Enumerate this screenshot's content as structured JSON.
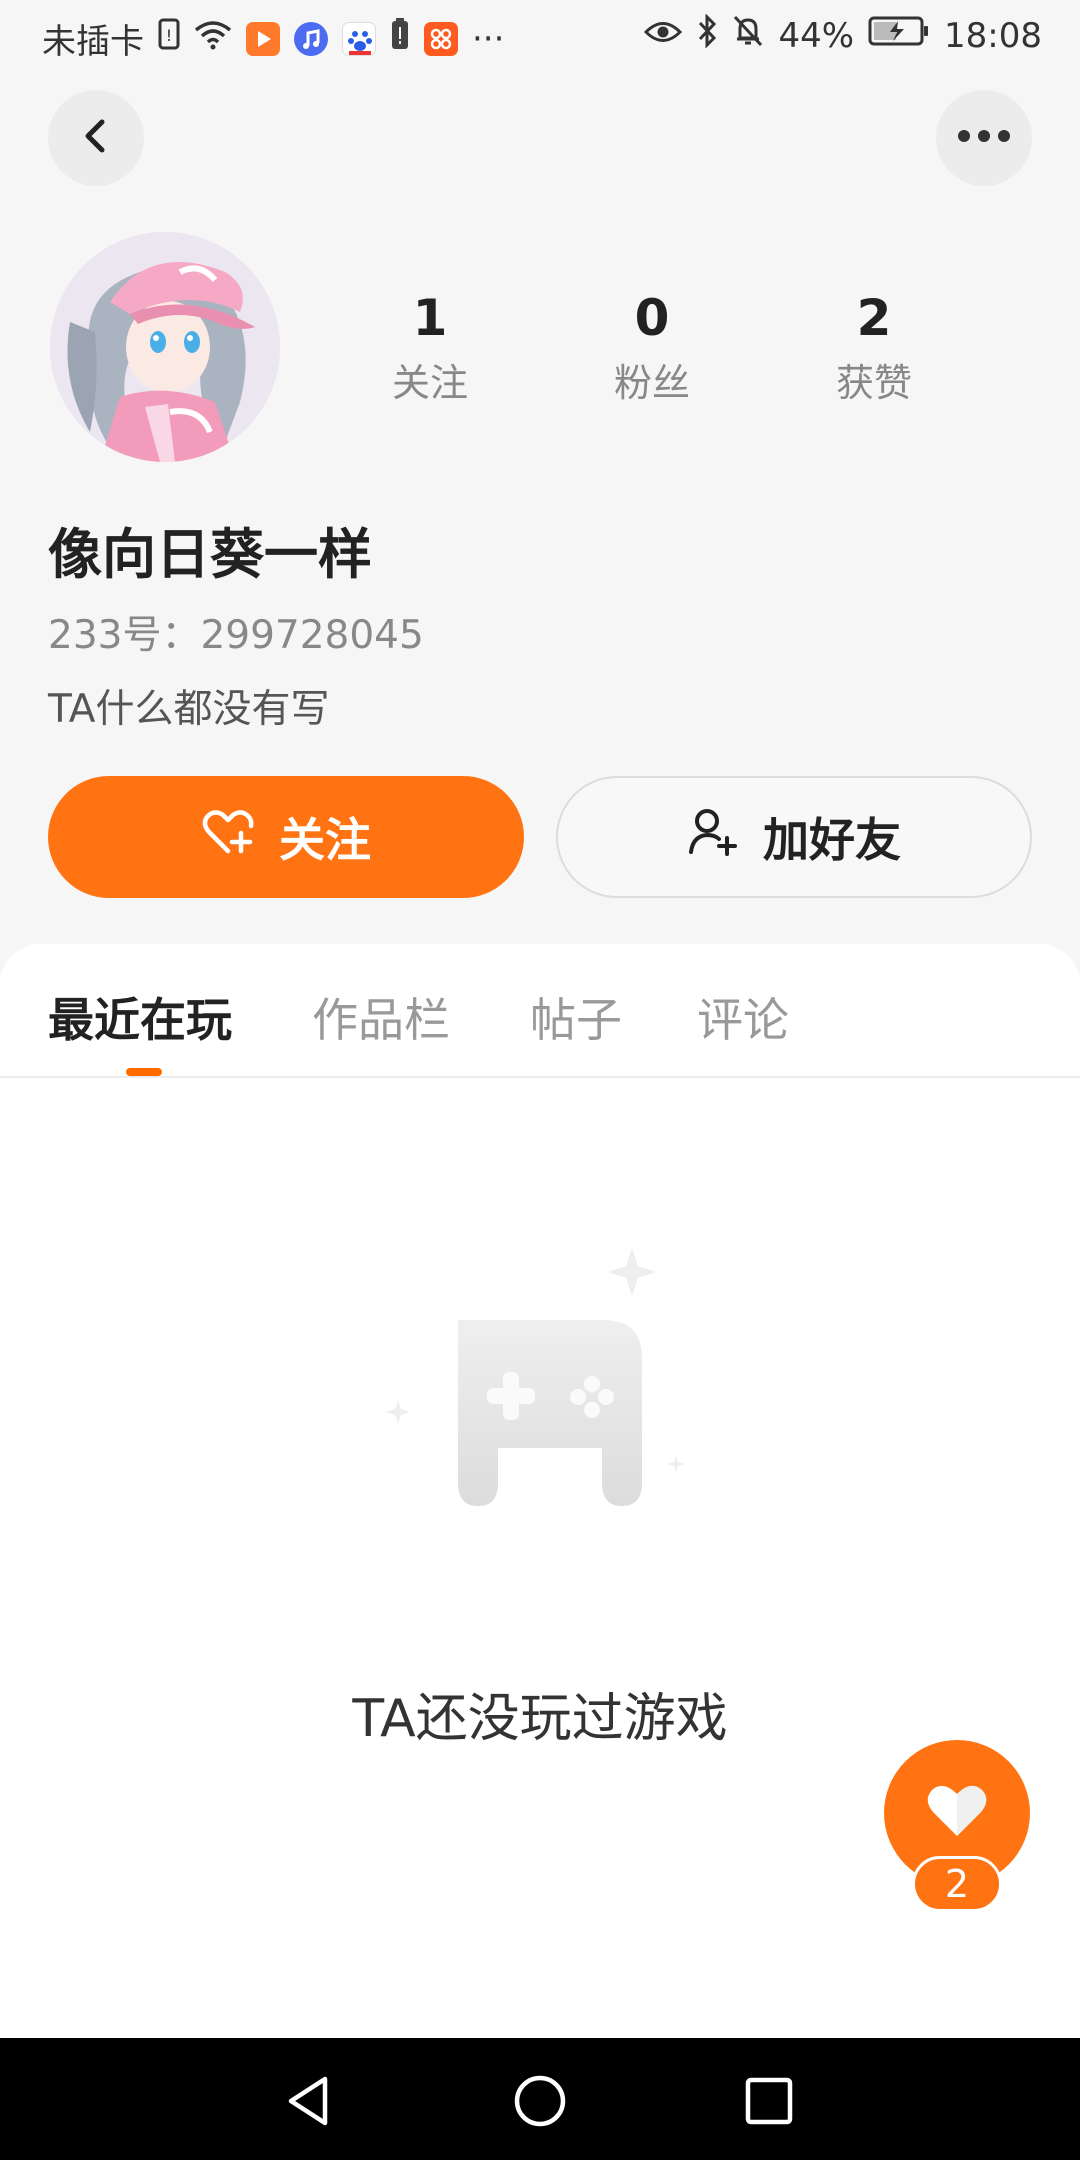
{
  "status_bar": {
    "carrier": "未插卡",
    "battery": "44%",
    "time": "18:08",
    "more_indicator": "···"
  },
  "profile": {
    "stats": [
      {
        "value": "1",
        "label": "关注"
      },
      {
        "value": "0",
        "label": "粉丝"
      },
      {
        "value": "2",
        "label": "获赞"
      }
    ],
    "username": "像向日葵一样",
    "user_id": "233号：299728045",
    "bio": "TA什么都没有写"
  },
  "actions": {
    "follow_label": "关注",
    "add_friend_label": "加好友"
  },
  "tabs": [
    {
      "label": "最近在玩",
      "active": true
    },
    {
      "label": "作品栏",
      "active": false
    },
    {
      "label": "帖子",
      "active": false
    },
    {
      "label": "评论",
      "active": false
    }
  ],
  "empty_state": {
    "message": "TA还没玩过游戏"
  },
  "like_fab": {
    "count": "2"
  },
  "colors": {
    "accent": "#ff7312",
    "background": "#f6f6f6",
    "card": "#ffffff",
    "text_primary": "#222222",
    "text_secondary": "#888888"
  },
  "icons": {
    "back": "chevron-left-icon",
    "more": "more-horizontal-icon",
    "follow": "heart-plus-icon",
    "add_friend": "user-plus-icon",
    "empty": "gamepad-icon",
    "like": "heart-icon"
  }
}
